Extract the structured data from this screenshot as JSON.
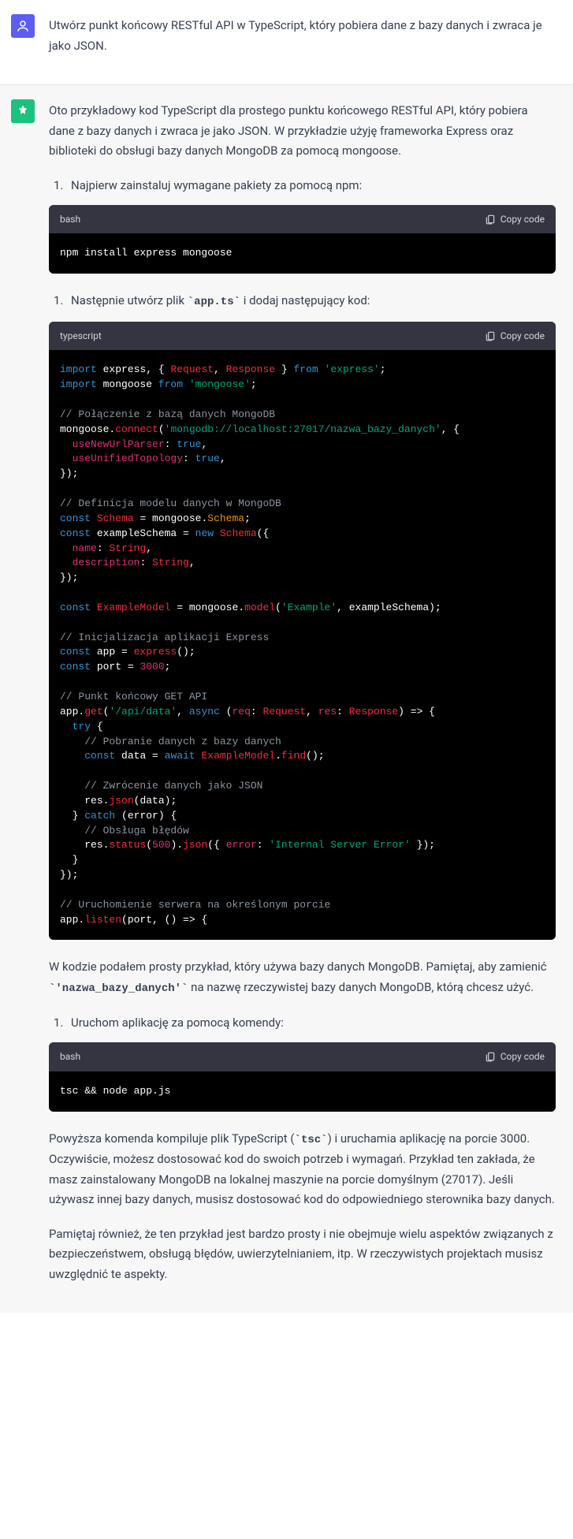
{
  "user": {
    "text": "Utwórz punkt końcowy RESTful API w TypeScript, który pobiera dane z bazy danych i zwraca je jako JSON."
  },
  "assistant": {
    "intro": "Oto przykładowy kod TypeScript dla prostego punktu końcowego RESTful API, który pobiera dane z bazy danych i zwraca je jako JSON. W przykładzie użyję frameworka Express oraz biblioteki do obsługi bazy danych MongoDB za pomocą mongoose.",
    "step1": "Najpierw zainstaluj wymagane pakiety za pomocą npm:",
    "step2_prefix": "Następnie utwórz plik ",
    "step2_code": "`app.ts`",
    "step2_suffix": " i dodaj następujący kod:",
    "after_code_prefix": "W kodzie podałem prosty przykład, który używa bazy danych MongoDB. Pamiętaj, aby zamienić ",
    "after_code_code": "`'nazwa_bazy_danych'`",
    "after_code_suffix": " na nazwę rzeczywistej bazy danych MongoDB, którą chcesz użyć.",
    "step3": "Uruchom aplikację za pomocą komendy:",
    "outro1_prefix": "Powyższa komenda kompiluje plik TypeScript (",
    "outro1_code": "`tsc`",
    "outro1_suffix": ") i uruchamia aplikację na porcie 3000. Oczywiście, możesz dostosować kod do swoich potrzeb i wymagań. Przykład ten zakłada, że masz zainstalowany MongoDB na lokalnej maszynie na porcie domyślnym (27017). Jeśli używasz innej bazy danych, musisz dostosować kod do odpowiedniego sterownika bazy danych.",
    "outro2": "Pamiętaj również, że ten przykład jest bardzo prosty i nie obejmuje wielu aspektów związanych z bezpieczeństwem, obsługą błędów, uwierzytelnianiem, itp. W rzeczywistych projektach musisz uwzględnić te aspekty."
  },
  "code": {
    "lang_bash": "bash",
    "lang_ts": "typescript",
    "copy_label": "Copy code",
    "bash1": "npm install express mongoose",
    "bash2": "tsc && node app.js"
  },
  "ts_tokens": {
    "import": "import",
    "from": "from",
    "express": " express, { ",
    "Request": "Request",
    "Response": "Response",
    "closing_brace_from": " } ",
    "express_str": "'express'",
    "semicolon": ";",
    "mongoose_w": " mongoose ",
    "mongoose_str": "'mongoose'",
    "cmt1": "// Połączenie z bazą danych MongoDB",
    "mongoose_t": "mongoose.",
    "connect": "connect",
    "paren_open": "(",
    "mongo_url": "'mongodb://localhost:27017/nazwa_bazy_danych'",
    "comma_brace": ", {",
    "useNewUrlParser": "useNewUrlParser",
    "colon_sp": ": ",
    "true": "true",
    "comma": ",",
    "useUnifiedTopology": "useUnifiedTopology",
    "close_obj": "});",
    "cmt2": "// Definicja modelu danych w MongoDB",
    "const": "const",
    "Schema": "Schema",
    "eq_mongoose": " = mongoose.",
    "Schema_t": "Schema",
    "exampleSchemaDecl": " exampleSchema = ",
    "new": "new",
    "SchemaCall": "Schema",
    "open_obj": "({",
    "name": "name",
    "String": "String",
    "description": "description",
    "ExampleModel": "ExampleModel",
    "eq_mongoose2": " = mongoose.",
    "model": "model",
    "Example_str": "'Example'",
    "comma_exschema": ", exampleSchema);",
    "cmt3": "// Inicjalizacja aplikacji Express",
    "app_decl": " app = ",
    "express_fn": "express",
    "empty_call": "();",
    "port_decl": " port = ",
    "num3000": "3000",
    "cmt4": "// Punkt końcowy GET API",
    "app_t": "app.",
    "get": "get",
    "api_data": "'/api/data'",
    "comma_sp": ", ",
    "async": "async",
    "sp_paren": " (",
    "req": "req",
    "res": "res",
    "arrow_brace": ") => {",
    "try": "try",
    "sp_brace": " {",
    "cmt5": "// Pobranie danych z bazy danych",
    "data_decl": " data = ",
    "await": "await",
    "ExampleModel_t": "ExampleModel",
    "dot": ".",
    "find": "find",
    "cmt6": "// Zwrócenie danych jako JSON",
    "res_t": "res.",
    "json": "json",
    "data_arg": "(data);",
    "close_brace_sp": "} ",
    "catch": "catch",
    "sp_error_brace": " (error) {",
    "cmt7": "// Obsługa błędów",
    "status": "status",
    "num500": "500",
    "paren_close_dot": ").",
    "json2": "json",
    "open_obj2": "({ ",
    "error_prop": "error",
    "ise": "'Internal Server Error'",
    "close_obj2": " });",
    "close_brace": "}",
    "cmt8": "// Uruchomienie serwera na określonym porcie",
    "listen": "listen",
    "port_arg": "(port, () => {"
  }
}
